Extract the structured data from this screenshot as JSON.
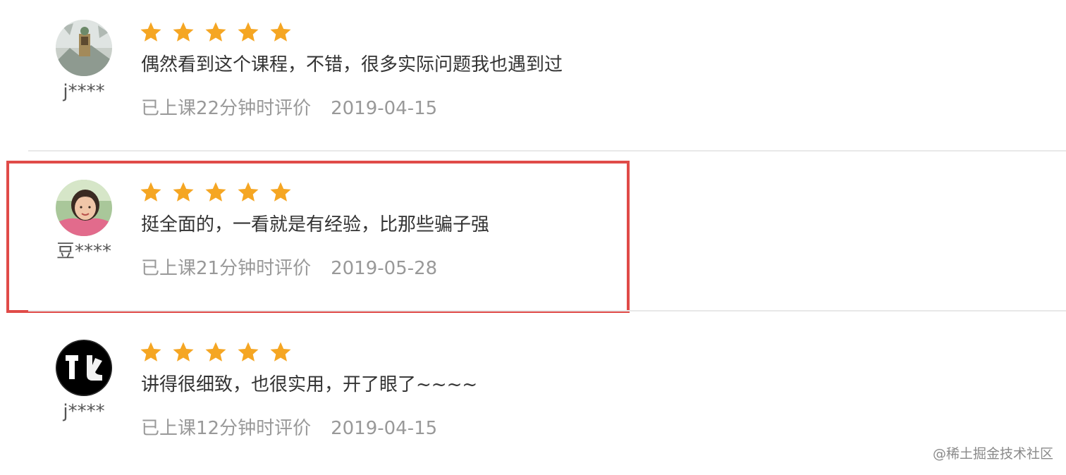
{
  "reviews": [
    {
      "username": "j****",
      "rating": 5,
      "comment": "偶然看到这个课程，不错，很多实际问题我也遇到过",
      "study_info": "已上课22分钟时评价",
      "date": "2019-04-15",
      "avatar_icon": "landscape-photo-avatar"
    },
    {
      "username": "豆****",
      "rating": 5,
      "comment": "挺全面的，一看就是有经验，比那些骗子强",
      "study_info": "已上课21分钟时评价",
      "date": "2019-05-28",
      "avatar_icon": "woman-portrait-avatar",
      "highlighted": true
    },
    {
      "username": "j****",
      "rating": 5,
      "comment": "讲得很细致，也很实用，开了眼了~~~~",
      "study_info": "已上课12分钟时评价",
      "date": "2019-04-15",
      "avatar_icon": "black-white-logo-avatar"
    }
  ],
  "watermark": "@稀土掘金技术社区",
  "colors": {
    "star": "#f5a623",
    "highlight_border": "#e04b48",
    "meta_text": "#999999",
    "comment_text": "#333333",
    "divider": "#e8e8e8"
  }
}
